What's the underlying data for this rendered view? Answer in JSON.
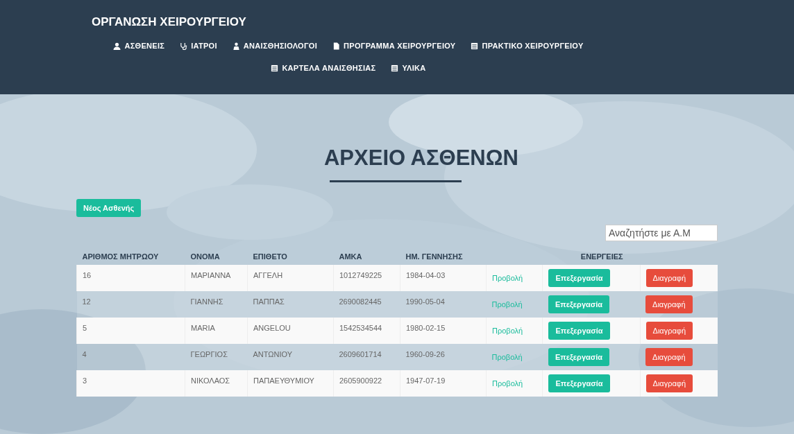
{
  "navbar": {
    "brand": "ΟΡΓΑΝΩΣΗ ΧΕΙΡΟΥΡΓΕΙΟΥ",
    "items": [
      {
        "label": "ΑΣΘΕΝΕΙΣ",
        "kind": "user"
      },
      {
        "label": "ΙΑΤΡΟΙ",
        "kind": "stethoscope"
      },
      {
        "label": "ΑΝΑΙΣΘΗΣΙΟΛΟΓΟΙ",
        "kind": "staff"
      },
      {
        "label": "ΠΡΟΓΡΑΜΜΑ ΧΕΙΡΟΥΡΓΕΙΟΥ",
        "kind": "file"
      },
      {
        "label": "ΠΡΑΚΤΙΚΟ ΧΕΙΡΟΥΡΓΕΙΟΥ",
        "kind": "sheet"
      },
      {
        "label": "ΚΑΡΤΕΛΑ ΑΝΑΙΣΘΗΣΙΑΣ",
        "kind": "sheet"
      },
      {
        "label": "ΥΛΙΚΑ",
        "kind": "sheet"
      }
    ]
  },
  "page_title": "ΑΡΧΕΙΟ ΑΣΘΕΝΩΝ",
  "new_button": "Νέος Ασθενής",
  "search": {
    "placeholder": "Αναζητήστε με Α.Μ"
  },
  "table": {
    "columns": [
      "ΑΡΙΘΜΟΣ ΜΗΤΡΩΟΥ",
      "ΟΝΟΜΑ",
      "ΕΠΙΘΕΤΟ",
      "ΑΜΚΑ",
      "ΗΜ. ΓΕΝΝΗΣΗΣ",
      "ΕΝΕΡΓΕΙΕΣ"
    ],
    "rows": [
      {
        "cells": [
          "16",
          "ΜΑΡΙΑΝΝΑ",
          "ΑΓΓΕΛΗ",
          "1012749225",
          "1984-04-03"
        ],
        "view": "Προβολή",
        "edit": "Επεξεργασία",
        "delete": "Διαγραφή"
      },
      {
        "cells": [
          "12",
          "ΓΙΑΝΝΗΣ",
          "ΠΑΠΠΑΣ",
          "2690082445",
          "1990-05-04"
        ],
        "view": "Προβολή",
        "edit": "Επεξεργασία",
        "delete": "Διαγραφή"
      },
      {
        "cells": [
          "5",
          "MARIA",
          "ANGELOU",
          "1542534544",
          "1980-02-15"
        ],
        "view": "Προβολή",
        "edit": "Επεξεργασία",
        "delete": "Διαγραφή"
      },
      {
        "cells": [
          "4",
          "ΓΕΩΡΓΙΟΣ",
          "ΑΝΤΩΝΙΟΥ",
          "2609601714",
          "1960-09-26"
        ],
        "view": "Προβολή",
        "edit": "Επεξεργασία",
        "delete": "Διαγραφή"
      },
      {
        "cells": [
          "3",
          "ΝΙΚΟΛΑΟΣ",
          "ΠΑΠΑΕΥΘΥΜΙΟΥ",
          "2605900922",
          "1947-07-19"
        ],
        "view": "Προβολή",
        "edit": "Επεξεργασία",
        "delete": "Διαγραφή"
      }
    ]
  }
}
